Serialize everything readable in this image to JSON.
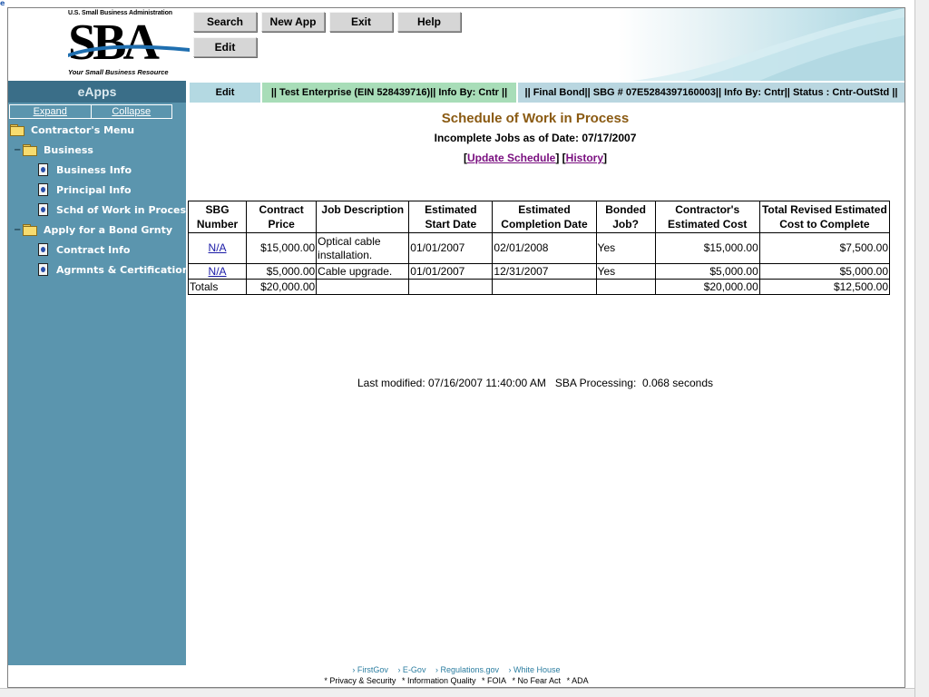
{
  "logo": {
    "top_text": "U.S. Small Business Administration",
    "letters": "SBA",
    "tagline": "Your Small Business Resource"
  },
  "toolbar": {
    "buttons": [
      "Search",
      "New App",
      "Exit",
      "Help",
      "Edit"
    ]
  },
  "navbar": {
    "app_name": "eApps",
    "edit_tab": "Edit",
    "info_enterprise": "|| Test Enterprise (EIN 528439716)|| Info By:  Cntr ||",
    "info_bond": "|| Final Bond|| SBG # 07E5284397160003|| Info By:  Cntr|| Status :  Cntr-OutStd ||"
  },
  "sidebar": {
    "expand": "Expand",
    "collapse": "Collapse",
    "items": [
      {
        "label": "Contractor's Menu",
        "icon": "folder-icon"
      },
      {
        "label": "Business",
        "icon": "folder-icon"
      },
      {
        "label": "Business Info",
        "icon": "document-icon"
      },
      {
        "label": "Principal Info",
        "icon": "document-icon"
      },
      {
        "label": "Schd of Work in Process",
        "icon": "document-icon"
      },
      {
        "label": "Apply for a Bond Grnty",
        "icon": "folder-icon"
      },
      {
        "label": "Contract Info",
        "icon": "document-icon"
      },
      {
        "label": "Agrmnts & Certification",
        "icon": "document-icon"
      }
    ]
  },
  "main": {
    "title": "Schedule of Work in Process",
    "subtitle": "Incomplete Jobs as of Date: 07/17/2007",
    "link_update": "Update Schedule",
    "link_history": "History",
    "table": {
      "headers": [
        "SBG Number",
        "Contract Price",
        "Job Description",
        "Estimated Start Date",
        "Estimated Completion Date",
        "Bonded Job?",
        "Contractor's Estimated Cost",
        "Total Revised Estimated Cost to Complete"
      ],
      "rows": [
        {
          "sbg": "N/A",
          "price": "$15,000.00",
          "desc": "Optical cable installation.",
          "start": "01/01/2007",
          "completion": "02/01/2008",
          "bonded": "Yes",
          "est_cost": "$15,000.00",
          "revised": "$7,500.00"
        },
        {
          "sbg": "N/A",
          "price": "$5,000.00",
          "desc": "Cable upgrade.",
          "start": "01/01/2007",
          "completion": "12/31/2007",
          "bonded": "Yes",
          "est_cost": "$5,000.00",
          "revised": "$5,000.00"
        }
      ],
      "totals": {
        "label": "Totals",
        "price": "$20,000.00",
        "est_cost": "$20,000.00",
        "revised": "$12,500.00"
      }
    },
    "last_modified": "Last modified: 07/16/2007 11:40:00 AM   SBA Processing:  0.068 seconds"
  },
  "footer": {
    "links": [
      "› FirstGov",
      "› E-Gov",
      "› Regulations.gov",
      "› White House"
    ],
    "bottom": [
      "* Privacy & Security",
      "* Information Quality",
      "* FOIA",
      "* No Fear Act",
      "* ADA"
    ]
  }
}
